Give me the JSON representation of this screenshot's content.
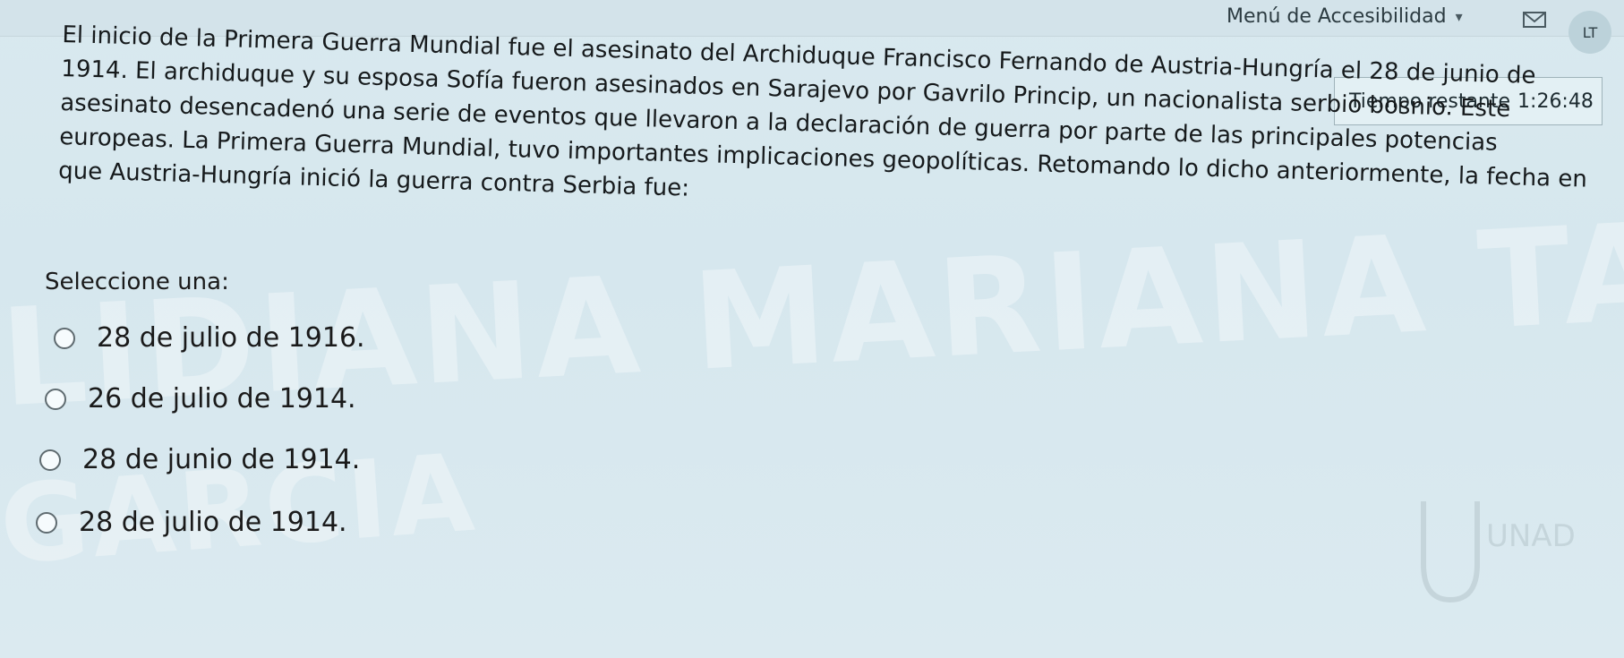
{
  "header": {
    "accessibility_menu": "Menú de Accesibilidad",
    "avatar_initials": "LT"
  },
  "timer": {
    "label": "Tiempo restante",
    "value": "1:26:48"
  },
  "question": {
    "text": "El inicio de la Primera Guerra Mundial fue el asesinato del Archiduque Francisco Fernando de Austria-Hungría el 28 de junio de 1914. El archiduque y su esposa Sofía fueron asesinados en Sarajevo por Gavrilo Princip, un nacionalista serbio bosnio. Este asesinato desencadenó una serie de eventos que llevaron a la declaración de guerra por parte de las principales potencias europeas. La Primera Guerra Mundial, tuvo importantes implicaciones geopolíticas. Retomando lo dicho anteriormente, la fecha en que Austria-Hungría inició la guerra contra Serbia fue:",
    "prompt": "Seleccione una:",
    "options": [
      "28 de julio de 1916.",
      "26 de julio de 1914.",
      "28 de junio de 1914.",
      "28 de julio de 1914."
    ]
  },
  "watermark": {
    "line1": "LIDIANA MARIANA TAPIAS",
    "line2": "GARCIA"
  },
  "logo": {
    "text": "UNAD"
  }
}
